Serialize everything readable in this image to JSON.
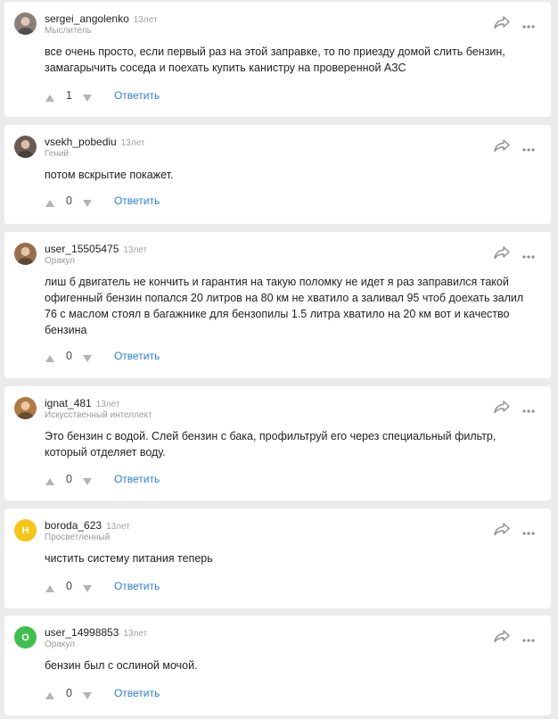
{
  "answers": [
    {
      "username": "sergei_angolenko",
      "time": "13лет",
      "rank": "Мыслитель",
      "avatar": {
        "type": "photo",
        "color": "#8a7f7a"
      },
      "text": "все очень просто, если первый раз на этой заправке, то по приезду домой слить бензин, замагарычить соседа и поехать купить канистру на проверенной АЗС",
      "votes": "1",
      "reply_label": "Ответить"
    },
    {
      "username": "vsekh_pobediu",
      "time": "13лет",
      "rank": "Гений",
      "avatar": {
        "type": "photo",
        "color": "#6b5a52"
      },
      "text": "потом вскрытие покажет.",
      "votes": "0",
      "reply_label": "Ответить"
    },
    {
      "username": "user_15505475",
      "time": "13лет",
      "rank": "Оракул",
      "avatar": {
        "type": "photo",
        "color": "#9b6f4a"
      },
      "text": "лиш б двигатель не кончить и гарантия на такую поломку не идет я раз заправился такой офигенный бензин попался 20 литров на 80 км не хватило а заливал 95 чтоб доехать залил 76 с маслом стоял в багажнике для бензопилы 1.5 литра хватило на 20 км вот и качество бензина",
      "votes": "0",
      "reply_label": "Ответить"
    },
    {
      "username": "ignat_481",
      "time": "13лет",
      "rank": "Искусственный интеллект",
      "avatar": {
        "type": "photo",
        "color": "#b07a45"
      },
      "text": "Это бензин с водой. Слей бензин с бака, профильтруй его через специальный фильтр, который отделяет воду.",
      "votes": "0",
      "reply_label": "Ответить"
    },
    {
      "username": "boroda_623",
      "time": "13лет",
      "rank": "Просветленный",
      "avatar": {
        "type": "letter",
        "letter": "Н",
        "color": "#f5c518"
      },
      "text": "чистить систему питания теперь",
      "votes": "0",
      "reply_label": "Ответить"
    },
    {
      "username": "user_14998853",
      "time": "13лет",
      "rank": "Оракул",
      "avatar": {
        "type": "letter",
        "letter": "О",
        "color": "#3fbf4f"
      },
      "text": "бензин был с ослиной мочой.",
      "votes": "0",
      "reply_label": "Ответить"
    }
  ],
  "colors": {
    "accent": "#2a7fd4",
    "background": "#ebebeb",
    "card": "#ffffff",
    "muted": "#a0a0a0"
  },
  "icons": {
    "share": "share-arrow-icon",
    "more": "three-dots-icon",
    "up": "arrow-up-triangle-icon",
    "down": "arrow-down-triangle-icon"
  }
}
